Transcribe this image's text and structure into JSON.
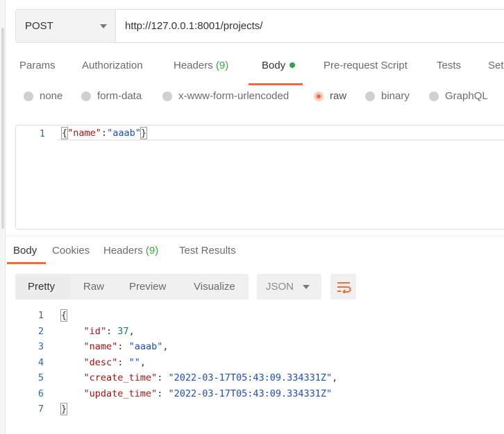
{
  "request": {
    "method": "POST",
    "url": "http://127.0.0.1:8001/projects/"
  },
  "request_tabs": [
    {
      "label": "Params"
    },
    {
      "label": "Authorization"
    },
    {
      "label": "Headers",
      "count": "(9)"
    },
    {
      "label": "Body",
      "active": true
    },
    {
      "label": "Pre-request Script"
    },
    {
      "label": "Tests"
    },
    {
      "label": "Set"
    }
  ],
  "body_types": [
    {
      "label": "none"
    },
    {
      "label": "form-data"
    },
    {
      "label": "x-www-form-urlencoded"
    },
    {
      "label": "raw",
      "selected": true
    },
    {
      "label": "binary"
    },
    {
      "label": "GraphQL"
    }
  ],
  "request_body": {
    "line_number": "1",
    "open": "{",
    "key": "\"name\"",
    "colon": ":",
    "value": "\"aaab\"",
    "close": "}"
  },
  "response_tabs": [
    {
      "label": "Body",
      "active": true
    },
    {
      "label": "Cookies"
    },
    {
      "label": "Headers",
      "count": "(9)"
    },
    {
      "label": "Test Results"
    }
  ],
  "response_views": [
    "Pretty",
    "Raw",
    "Preview",
    "Visualize"
  ],
  "response_format": "JSON",
  "response_lines": [
    {
      "n": "1",
      "open": "{"
    },
    {
      "n": "2",
      "key": "\"id\"",
      "num": "37",
      "tail": ","
    },
    {
      "n": "3",
      "key": "\"name\"",
      "str": "\"aaab\"",
      "tail": ","
    },
    {
      "n": "4",
      "key": "\"desc\"",
      "str": "\"\"",
      "tail": ","
    },
    {
      "n": "5",
      "key": "\"create_time\"",
      "str": "\"2022-03-17T05:43:09.334331Z\"",
      "tail": ","
    },
    {
      "n": "6",
      "key": "\"update_time\"",
      "str": "\"2022-03-17T05:43:09.334331Z\"",
      "tail": ""
    },
    {
      "n": "7",
      "close": "}"
    }
  ],
  "icons": {
    "wrap": "wrap-lines-icon",
    "caret": "chevron-down-icon"
  },
  "colors": {
    "accent": "#f26b3a",
    "count_green": "#3aa53a",
    "dot_green": "#2da64b"
  }
}
